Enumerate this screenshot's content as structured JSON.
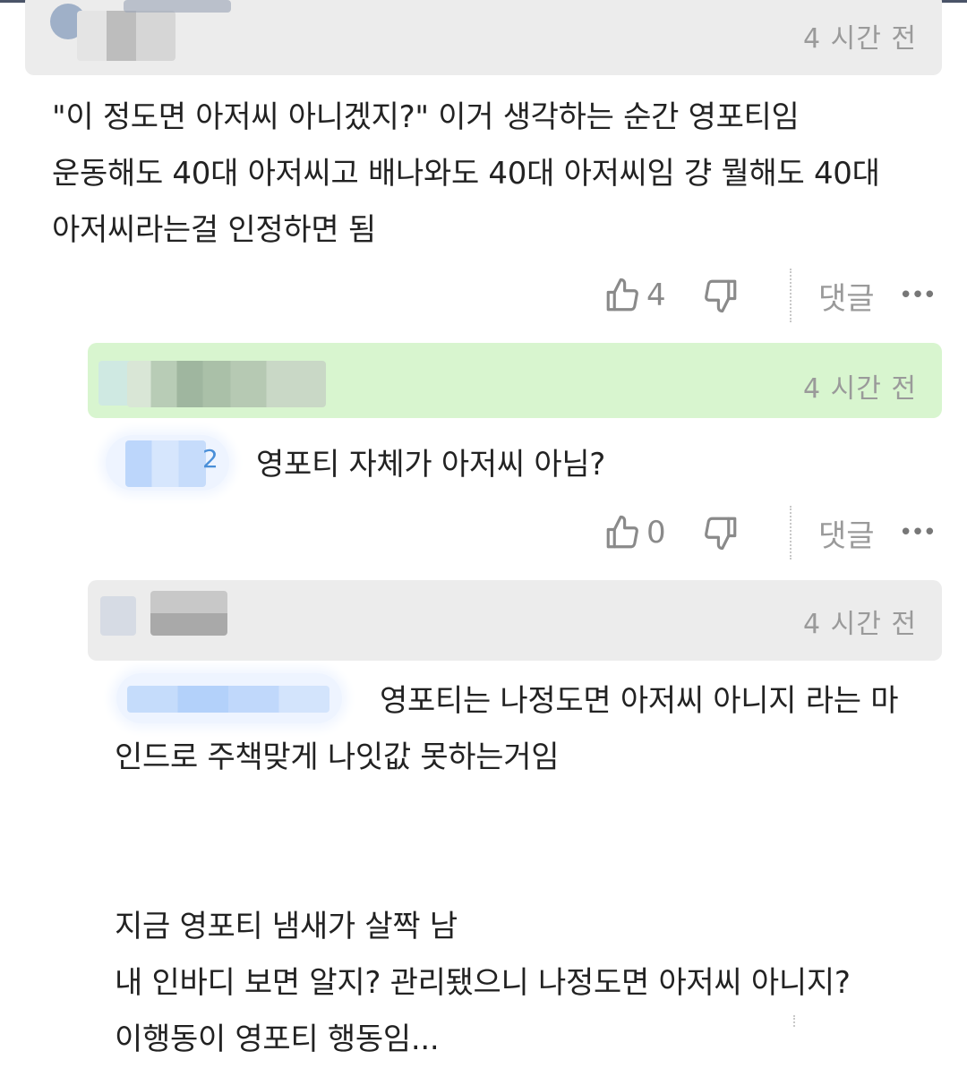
{
  "comments": [
    {
      "time": "4 시간 전",
      "text": "\"이 정도면 아저씨 아니겠지?\" 이거 생각하는 순간 영포티임\n운동해도 40대 아저씨고 배나와도 40대 아저씨임 걍 뭘해도 40대\n아저씨라는걸 인정하면 됨",
      "likes": "4",
      "reply_label": "댓글",
      "more_label": "•••"
    },
    {
      "time": "4 시간 전",
      "text": "영포티 자체가 아저씨 아님?",
      "likes": "0",
      "reply_label": "댓글",
      "more_label": "•••"
    },
    {
      "time": "4 시간 전",
      "text_line1": "영포티는 나정도면 아저씨 아니지 라는 마",
      "text_rest": "인드로 주책맞게 나잇값 못하는거임\n\n\n지금 영포티 냄새가 살짝 남\n내 인바디 보면 알지? 관리됐으니 나정도면 아저씨 아니지?\n이행동이 영포티 행동임..."
    }
  ],
  "colors": {
    "highlight_header": "#d8f5cf",
    "header": "#ececec",
    "mention": "#4a8fd8"
  }
}
